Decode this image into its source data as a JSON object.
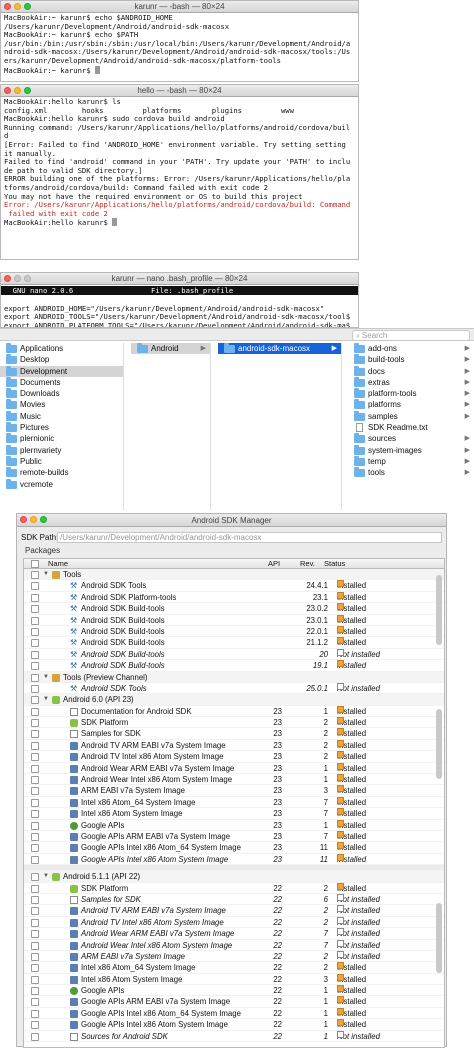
{
  "term1": {
    "title": "karunr — -bash — 80×24",
    "lines": [
      "MacBookAir:~ karunr$ echo $ANDROID_HOME",
      "/Users/karunr/Development/Android/android-sdk-macosx",
      "MacBookAir:~ karunr$ echo $PATH",
      "/usr/bin:/bin:/usr/sbin:/sbin:/usr/local/bin:/Users/karunr/Development/Android/a",
      "ndroid-sdk-macosx:/Users/karunr/Development/Android/android-sdk-macosx/tools:/Us",
      "ers/karunr/Development/Android/android-sdk-macosx/platform-tools",
      "MacBookAir:~ karunr$ "
    ]
  },
  "term2": {
    "title": "hello — -bash — 80×24",
    "lines": [
      "MacBookAir:hello karunr$ ls",
      "config.xml        hooks         platforms       plugins         www",
      "MacBookAir:hello karunr$ sudo cordova build android",
      "Running command: /Users/karunr/Applications/hello/platforms/android/cordova/buil",
      "d",
      "[Error: Failed to find 'ANDROID_HOME' environment variable. Try setting setting",
      "it manually.",
      "Failed to find 'android' command in your 'PATH'. Try update your 'PATH' to inclu",
      "de path to valid SDK directory.]",
      "ERROR building one of the platforms: Error: /Users/karunr/Applications/hello/pla",
      "tforms/android/cordova/build: Command failed with exit code 2",
      "You may not have the required environment or OS to build this project"
    ],
    "error_lines": [
      "Error: /Users/karunr/Applications/hello/platforms/android/cordova/build: Command",
      " failed with exit code 2"
    ],
    "prompt": "MacBookAir:hello karunr$ "
  },
  "term3": {
    "title": "karunr — nano .bash_profile — 80×24",
    "nano_left": "  GNU nano 2.0.6",
    "nano_right": "File: .bash_profile",
    "lines": [
      "",
      "export ANDROID_HOME=\"/Users/karunr/Development/Android/android-sdk-macosx\"",
      "export ANDROID_TOOLS=\"/Users/karunr/Development/Android/android-sdk-macosx/tool$",
      "export ANDROID_PLATFORM_TOOLS=\"/Users/karunr/Development/Android/android-sdk-ma$",
      "PATH=$PATH:$ANDROID_HOME:$ANDROID_TOOLS:$ANDROID_PLATFORM_TOOLS"
    ]
  },
  "finder": {
    "search_placeholder": "Search",
    "col1": [
      {
        "label": "Applications"
      },
      {
        "label": "Desktop"
      },
      {
        "label": "Development",
        "state": "selg"
      },
      {
        "label": "Documents"
      },
      {
        "label": "Downloads"
      },
      {
        "label": "Movies"
      },
      {
        "label": "Music"
      },
      {
        "label": "Pictures"
      },
      {
        "label": "plernionic"
      },
      {
        "label": "plernvariety"
      },
      {
        "label": "Public"
      },
      {
        "label": "remote-builds"
      },
      {
        "label": "vcremote"
      }
    ],
    "col2": [
      {
        "label": "Android",
        "state": "selg"
      }
    ],
    "col3": [
      {
        "label": "android-sdk-macosx",
        "state": "sel"
      }
    ],
    "col4": [
      {
        "label": "add-ons",
        "kind": "folder"
      },
      {
        "label": "build-tools",
        "kind": "folder"
      },
      {
        "label": "docs",
        "kind": "folder"
      },
      {
        "label": "extras",
        "kind": "folder"
      },
      {
        "label": "platform-tools",
        "kind": "folder"
      },
      {
        "label": "platforms",
        "kind": "folder"
      },
      {
        "label": "samples",
        "kind": "folder"
      },
      {
        "label": "SDK Readme.txt",
        "kind": "file"
      },
      {
        "label": "sources",
        "kind": "folder"
      },
      {
        "label": "system-images",
        "kind": "folder"
      },
      {
        "label": "temp",
        "kind": "folder"
      },
      {
        "label": "tools",
        "kind": "folder"
      }
    ]
  },
  "sdk": {
    "title": "Android SDK Manager",
    "path_label": "SDK Path:",
    "path_value": "/Users/karunr/Development/Android/android-sdk-macosx",
    "packages_label": "Packages",
    "col_name": "Name",
    "col_api": "API",
    "col_rev": "Rev.",
    "col_status": "Status",
    "rows": [
      {
        "name": "Tools",
        "type": "cat",
        "icon": "fold"
      },
      {
        "name": "Android SDK Tools",
        "api": "",
        "rev": "24.4.1",
        "status": "Installed",
        "icon": "wr"
      },
      {
        "name": "Android SDK Platform-tools",
        "api": "",
        "rev": "23.1",
        "status": "Installed",
        "icon": "wr"
      },
      {
        "name": "Android SDK Build-tools",
        "api": "",
        "rev": "23.0.2",
        "status": "Installed",
        "icon": "wr"
      },
      {
        "name": "Android SDK Build-tools",
        "api": "",
        "rev": "23.0.1",
        "status": "Installed",
        "icon": "wr"
      },
      {
        "name": "Android SDK Build-tools",
        "api": "",
        "rev": "22.0.1",
        "status": "Installed",
        "icon": "wr"
      },
      {
        "name": "Android SDK Build-tools",
        "api": "",
        "rev": "21.1.2",
        "status": "Installed",
        "icon": "wr"
      },
      {
        "name": "Android SDK Build-tools",
        "api": "",
        "rev": "20",
        "status": "Not installed",
        "icon": "wr",
        "italic": true
      },
      {
        "name": "Android SDK Build-tools",
        "api": "",
        "rev": "19.1",
        "status": "Installed",
        "icon": "wr",
        "italic": true
      },
      {
        "name": "Tools (Preview Channel)",
        "type": "cat",
        "icon": "fold"
      },
      {
        "name": "Android SDK Tools",
        "api": "",
        "rev": "25.0.1",
        "status": "Not installed",
        "icon": "wr",
        "italic": true
      },
      {
        "name": "Android 6.0 (API 23)",
        "type": "cat",
        "icon": "and"
      },
      {
        "name": "Documentation for Android SDK",
        "api": "23",
        "rev": "1",
        "status": "Installed",
        "icon": "doc"
      },
      {
        "name": "SDK Platform",
        "api": "23",
        "rev": "2",
        "status": "Installed",
        "icon": "and"
      },
      {
        "name": "Samples for SDK",
        "api": "23",
        "rev": "2",
        "status": "Installed",
        "icon": "doc"
      },
      {
        "name": "Android TV ARM EABI v7a System Image",
        "api": "23",
        "rev": "2",
        "status": "Installed",
        "icon": "img"
      },
      {
        "name": "Android TV Intel x86 Atom System Image",
        "api": "23",
        "rev": "2",
        "status": "Installed",
        "icon": "img"
      },
      {
        "name": "Android Wear ARM EABI v7a System Image",
        "api": "23",
        "rev": "1",
        "status": "Installed",
        "icon": "img"
      },
      {
        "name": "Android Wear Intel x86 Atom System Image",
        "api": "23",
        "rev": "1",
        "status": "Installed",
        "icon": "img"
      },
      {
        "name": "ARM EABI v7a System Image",
        "api": "23",
        "rev": "3",
        "status": "Installed",
        "icon": "img"
      },
      {
        "name": "Intel x86 Atom_64 System Image",
        "api": "23",
        "rev": "7",
        "status": "Installed",
        "icon": "img"
      },
      {
        "name": "Intel x86 Atom System Image",
        "api": "23",
        "rev": "7",
        "status": "Installed",
        "icon": "img"
      },
      {
        "name": "Google APIs",
        "api": "23",
        "rev": "1",
        "status": "Installed",
        "icon": "goo"
      },
      {
        "name": "Google APIs ARM EABI v7a System Image",
        "api": "23",
        "rev": "7",
        "status": "Installed",
        "icon": "img"
      },
      {
        "name": "Google APIs Intel x86 Atom_64 System Image",
        "api": "23",
        "rev": "11",
        "status": "Installed",
        "icon": "img"
      },
      {
        "name": "Google APIs Intel x86 Atom System Image",
        "api": "23",
        "rev": "11",
        "status": "Installed",
        "icon": "img",
        "italic": true
      },
      {
        "name": "",
        "type": "gap"
      },
      {
        "name": "Android 5.1.1 (API 22)",
        "type": "cat",
        "icon": "and"
      },
      {
        "name": "SDK Platform",
        "api": "22",
        "rev": "2",
        "status": "Installed",
        "icon": "and"
      },
      {
        "name": "Samples for SDK",
        "api": "22",
        "rev": "6",
        "status": "Not installed",
        "icon": "doc",
        "italic": true
      },
      {
        "name": "Android TV ARM EABI v7a System Image",
        "api": "22",
        "rev": "2",
        "status": "Not installed",
        "icon": "img",
        "italic": true
      },
      {
        "name": "Android TV Intel x86 Atom System Image",
        "api": "22",
        "rev": "2",
        "status": "Not installed",
        "icon": "img",
        "italic": true
      },
      {
        "name": "Android Wear ARM EABI v7a System Image",
        "api": "22",
        "rev": "7",
        "status": "Not installed",
        "icon": "img",
        "italic": true
      },
      {
        "name": "Android Wear Intel x86 Atom System Image",
        "api": "22",
        "rev": "7",
        "status": "Not installed",
        "icon": "img",
        "italic": true
      },
      {
        "name": "ARM EABI v7a System Image",
        "api": "22",
        "rev": "2",
        "status": "Not installed",
        "icon": "img",
        "italic": true
      },
      {
        "name": "Intel x86 Atom_64 System Image",
        "api": "22",
        "rev": "2",
        "status": "Installed",
        "icon": "img"
      },
      {
        "name": "Intel x86 Atom System Image",
        "api": "22",
        "rev": "3",
        "status": "Installed",
        "icon": "img"
      },
      {
        "name": "Google APIs",
        "api": "22",
        "rev": "1",
        "status": "Installed",
        "icon": "goo"
      },
      {
        "name": "Google APIs ARM EABI v7a System Image",
        "api": "22",
        "rev": "1",
        "status": "Installed",
        "icon": "img"
      },
      {
        "name": "Google APIs Intel x86 Atom_64 System Image",
        "api": "22",
        "rev": "1",
        "status": "Installed",
        "icon": "img"
      },
      {
        "name": "Google APIs Intel x86 Atom System Image",
        "api": "22",
        "rev": "1",
        "status": "Installed",
        "icon": "img"
      },
      {
        "name": "Sources for Android SDK",
        "api": "22",
        "rev": "1",
        "status": "Not installed",
        "icon": "doc",
        "italic": true
      }
    ]
  }
}
